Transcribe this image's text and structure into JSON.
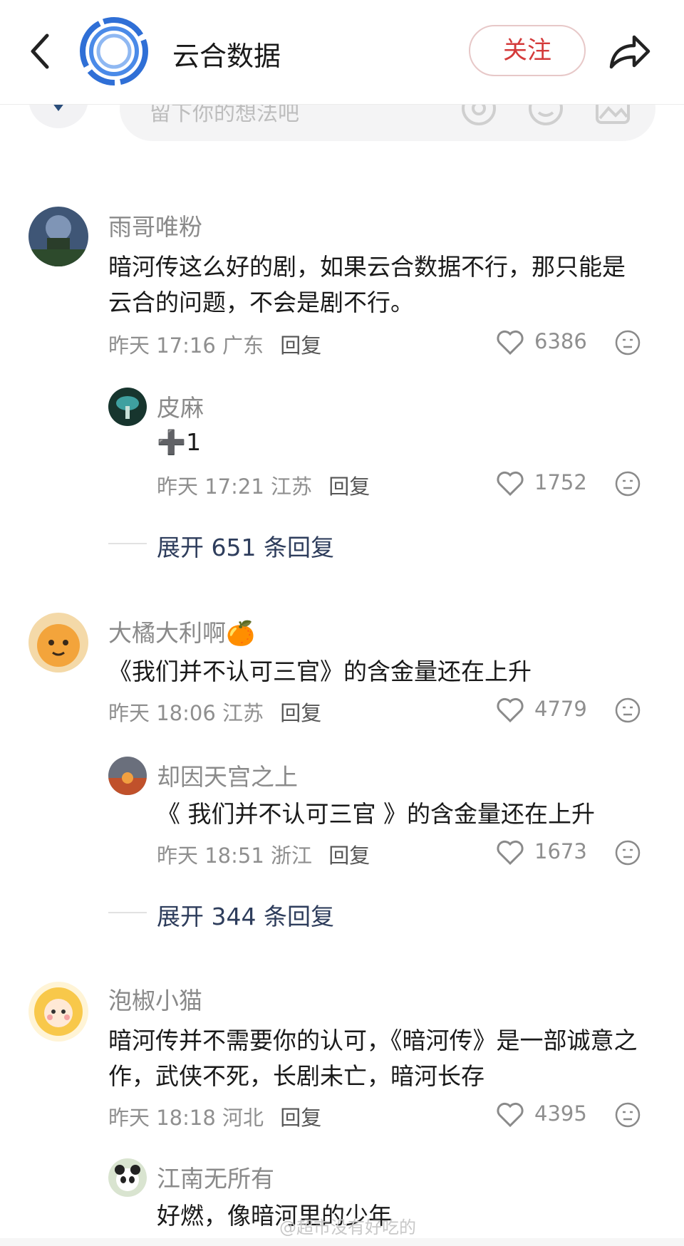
{
  "header": {
    "title": "云合数据",
    "follow_label": "关注"
  },
  "input": {
    "placeholder": "留下你的想法吧"
  },
  "comments": [
    {
      "user": "雨哥唯粉",
      "text": "暗河传这么好的剧，如果云合数据不行，那只能是云合的问题，不会是剧不行。",
      "time": "昨天 17:16",
      "location": "广东",
      "reply_label": "回复",
      "likes": "6386",
      "sub": {
        "user": "皮麻",
        "text": "➕1",
        "time": "昨天 17:21",
        "location": "江苏",
        "reply_label": "回复",
        "likes": "1752"
      },
      "expand": "展开 651 条回复"
    },
    {
      "user": "大橘大利啊🍊",
      "text": "《我们并不认可三官》的含金量还在上升",
      "time": "昨天 18:06",
      "location": "江苏",
      "reply_label": "回复",
      "likes": "4779",
      "sub": {
        "user": "却因天宫之上",
        "text": "《 我们并不认可三官 》的含金量还在上升",
        "time": "昨天 18:51",
        "location": "浙江",
        "reply_label": "回复",
        "likes": "1673"
      },
      "expand": "展开 344 条回复"
    },
    {
      "user": "泡椒小猫",
      "text": "暗河传并不需要你的认可，《暗河传》是一部诚意之作，武侠不死，长剧未亡，暗河长存",
      "time": "昨天 18:18",
      "location": "河北",
      "reply_label": "回复",
      "likes": "4395",
      "sub": {
        "user": "江南无所有",
        "text": "好燃，像暗河里的少年"
      }
    }
  ],
  "watermark": "@超市没有好吃的",
  "colors": {
    "accent_red": "#d43a3a",
    "link_blue": "#2e3d5c",
    "meta_gray": "#8f8f8f"
  }
}
